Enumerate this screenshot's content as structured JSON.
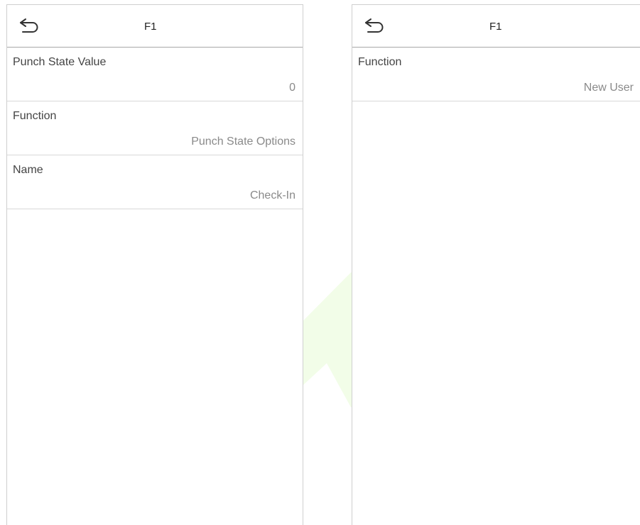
{
  "left_screen": {
    "title": "F1",
    "rows": [
      {
        "label": "Punch State Value",
        "value": "0"
      },
      {
        "label": "Function",
        "value": "Punch State Options"
      },
      {
        "label": "Name",
        "value": "Check-In"
      }
    ]
  },
  "right_screen": {
    "title": "F1",
    "rows": [
      {
        "label": "Function",
        "value": "New User"
      }
    ]
  },
  "icons": {
    "back": "back-arrow-icon",
    "watermark": "arrow-watermark-icon"
  },
  "colors": {
    "watermark": "#f2fde8",
    "header_divider": "#a8a8a8",
    "row_divider": "#d9d9d9",
    "value_text": "#8a8a8a"
  }
}
